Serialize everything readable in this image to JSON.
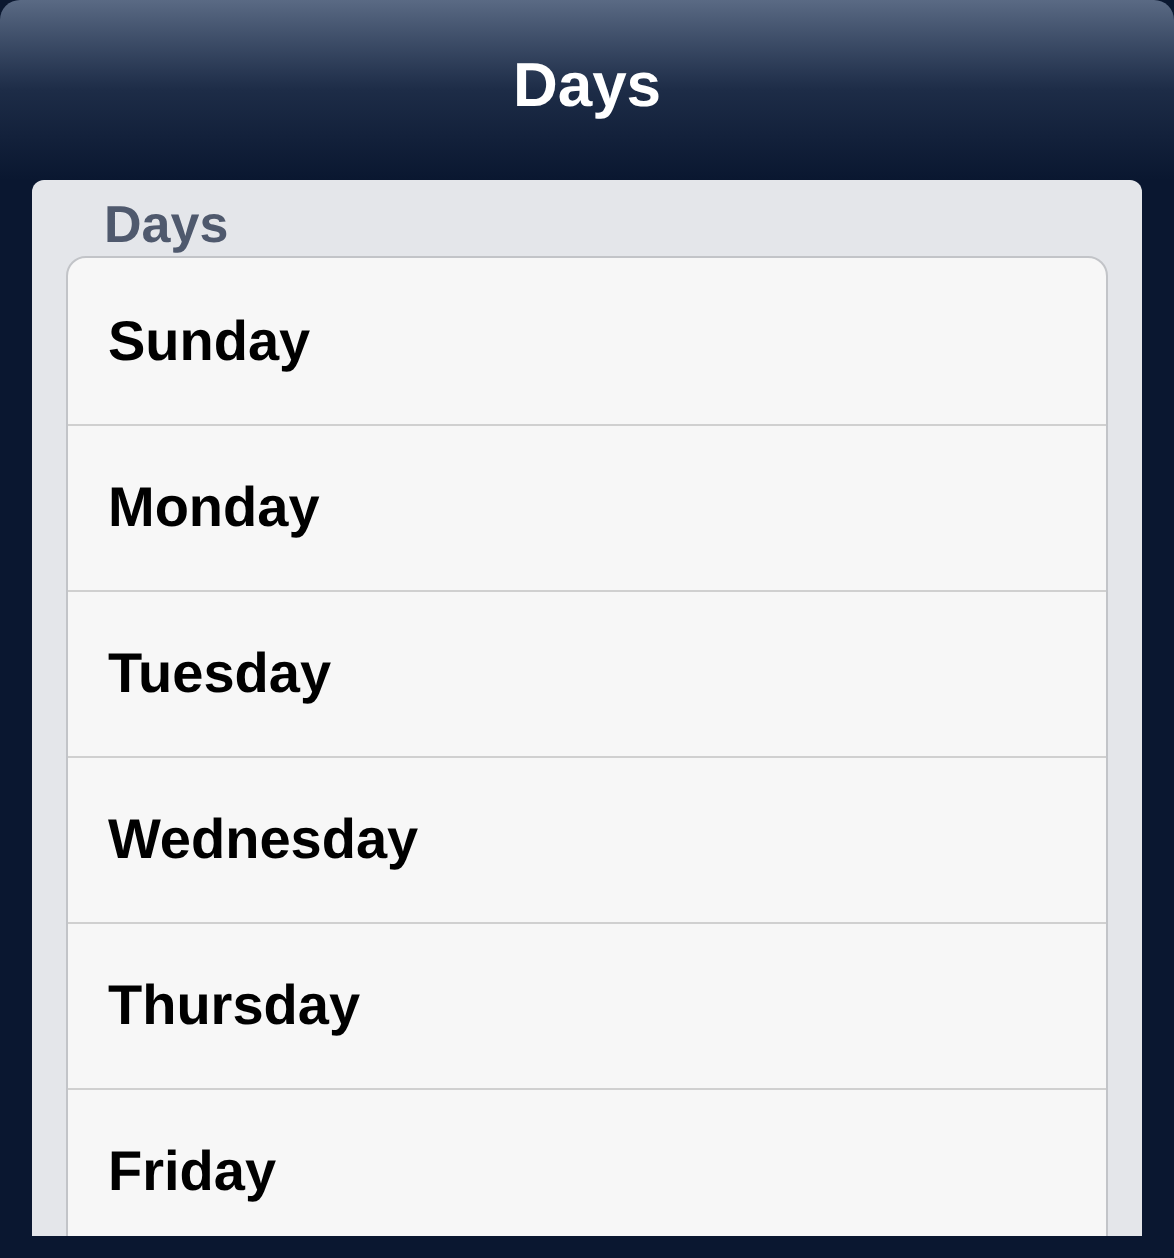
{
  "nav_bar": {
    "title": "Days"
  },
  "section": {
    "header": "Days",
    "rows": [
      {
        "label": "Sunday"
      },
      {
        "label": "Monday"
      },
      {
        "label": "Tuesday"
      },
      {
        "label": "Wednesday"
      },
      {
        "label": "Thursday"
      },
      {
        "label": "Friday"
      }
    ]
  }
}
